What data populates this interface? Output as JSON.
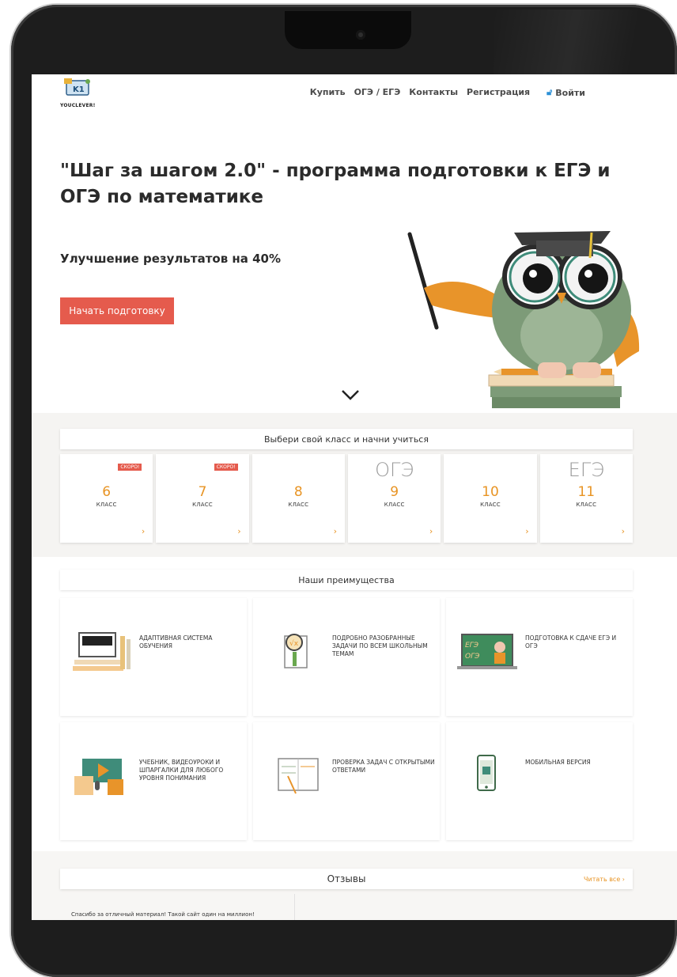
{
  "header": {
    "logo_text": "YOUCLEVER!",
    "nav": [
      {
        "label": "Купить"
      },
      {
        "label": "ОГЭ / ЕГЭ"
      },
      {
        "label": "Контакты"
      },
      {
        "label": "Регистрация"
      }
    ],
    "login_label": "Войти"
  },
  "hero": {
    "title": "\"Шаг за шагом 2.0\" - программа подготовки к ЕГЭ и ОГЭ по математике",
    "subtitle": "Улучшение результатов на 40%",
    "cta_label": "Начать подготовку"
  },
  "grades": {
    "heading": "Выбери свой класс и начни учиться",
    "items": [
      {
        "exam": "",
        "number": "6",
        "label": "КЛАСС",
        "badge": "СКОРО!"
      },
      {
        "exam": "",
        "number": "7",
        "label": "КЛАСС",
        "badge": "СКОРО!"
      },
      {
        "exam": "",
        "number": "8",
        "label": "КЛАСС",
        "badge": ""
      },
      {
        "exam": "ОГЭ",
        "number": "9",
        "label": "КЛАСС",
        "badge": ""
      },
      {
        "exam": "",
        "number": "10",
        "label": "КЛАСС",
        "badge": ""
      },
      {
        "exam": "ЕГЭ",
        "number": "11",
        "label": "КЛАСС",
        "badge": ""
      }
    ],
    "arrow": "›"
  },
  "advantages": {
    "heading": "Наши преимущества",
    "items": [
      {
        "text": "Адаптивная система обучения",
        "icon": "adaptive-system-icon"
      },
      {
        "text": "Подробно разобранные задачи по всем школьным темам",
        "icon": "magnifier-icon"
      },
      {
        "text": "Подготовка к сдаче ЕГЭ и ОГЭ",
        "icon": "exam-board-icon"
      },
      {
        "text": "Учебник, видеоуроки и шпаргалки для любого уровня понимания",
        "icon": "video-lessons-icon"
      },
      {
        "text": "Проверка задач с открытыми ответами",
        "icon": "notebook-icon"
      },
      {
        "text": "Мобильная версия",
        "icon": "mobile-icon"
      }
    ]
  },
  "reviews": {
    "heading": "Отзывы",
    "read_all": "Читать все",
    "first_review": "Спасибо за отличный материал! Такой сайт один на миллион!"
  },
  "colors": {
    "accent_red": "#e55b4d",
    "accent_orange": "#e89424",
    "owl_green": "#7d9b78",
    "nav_text": "#4b4b4b"
  }
}
